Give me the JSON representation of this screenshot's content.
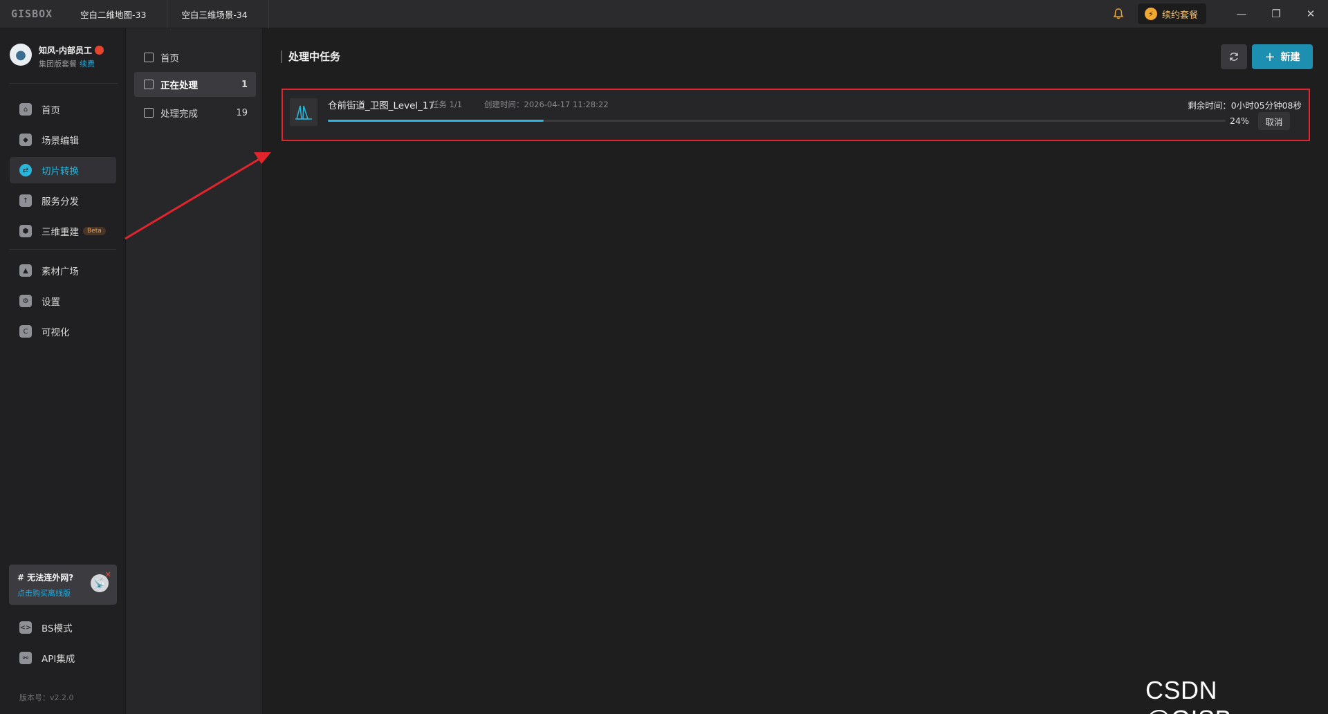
{
  "app": {
    "logo": "GISBOX"
  },
  "tabs": [
    {
      "label": "空白二维地图-33"
    },
    {
      "label": "空白三维场景-34"
    }
  ],
  "titlebar": {
    "bell_icon": "bell-icon",
    "renew_label": "续约套餐",
    "window_controls": [
      "minimize",
      "restore",
      "close"
    ]
  },
  "profile": {
    "name": "知风-内部员工",
    "plan": "集团版套餐",
    "renew_link": "续费"
  },
  "nav": {
    "items": [
      {
        "label": "首页",
        "icon": "home-icon"
      },
      {
        "label": "场景编辑",
        "icon": "cube-icon"
      },
      {
        "label": "切片转换",
        "icon": "convert-icon",
        "active": true
      },
      {
        "label": "服务分发",
        "icon": "upload-icon"
      },
      {
        "label": "三维重建",
        "icon": "hexagon-icon",
        "badge": "Beta"
      }
    ],
    "items2": [
      {
        "label": "素材广场",
        "icon": "image-icon"
      },
      {
        "label": "设置",
        "icon": "gear-icon"
      },
      {
        "label": "可视化",
        "icon": "visual-icon"
      }
    ],
    "items3": [
      {
        "label": "BS模式",
        "icon": "code-icon"
      },
      {
        "label": "API集成",
        "icon": "api-icon"
      }
    ]
  },
  "promo": {
    "title": "# 无法连外网?",
    "link": "点击购买离线版"
  },
  "version": "版本号：v2.2.0",
  "subnav": {
    "items": [
      {
        "label": "首页",
        "count": ""
      },
      {
        "label": "正在处理",
        "count": "1",
        "active": true
      },
      {
        "label": "处理完成",
        "count": "19"
      }
    ]
  },
  "main": {
    "title": "处理中任务",
    "new_label": "新建"
  },
  "task": {
    "name": "仓前街道_卫图_Level_17",
    "count": "任务 1/1",
    "created": "创建时间：2026-04-17 11:28:22",
    "remaining": "剩余时间：0小时05分钟08秒",
    "progress": 0.24,
    "percent_label": "24%",
    "cancel_label": "取消"
  },
  "watermark": "CSDN @GISBox",
  "colors": {
    "accent": "#29b6dc",
    "primary_button": "#1d8fb0",
    "highlight_border": "#e2242c",
    "arrow": "#e2242c"
  }
}
